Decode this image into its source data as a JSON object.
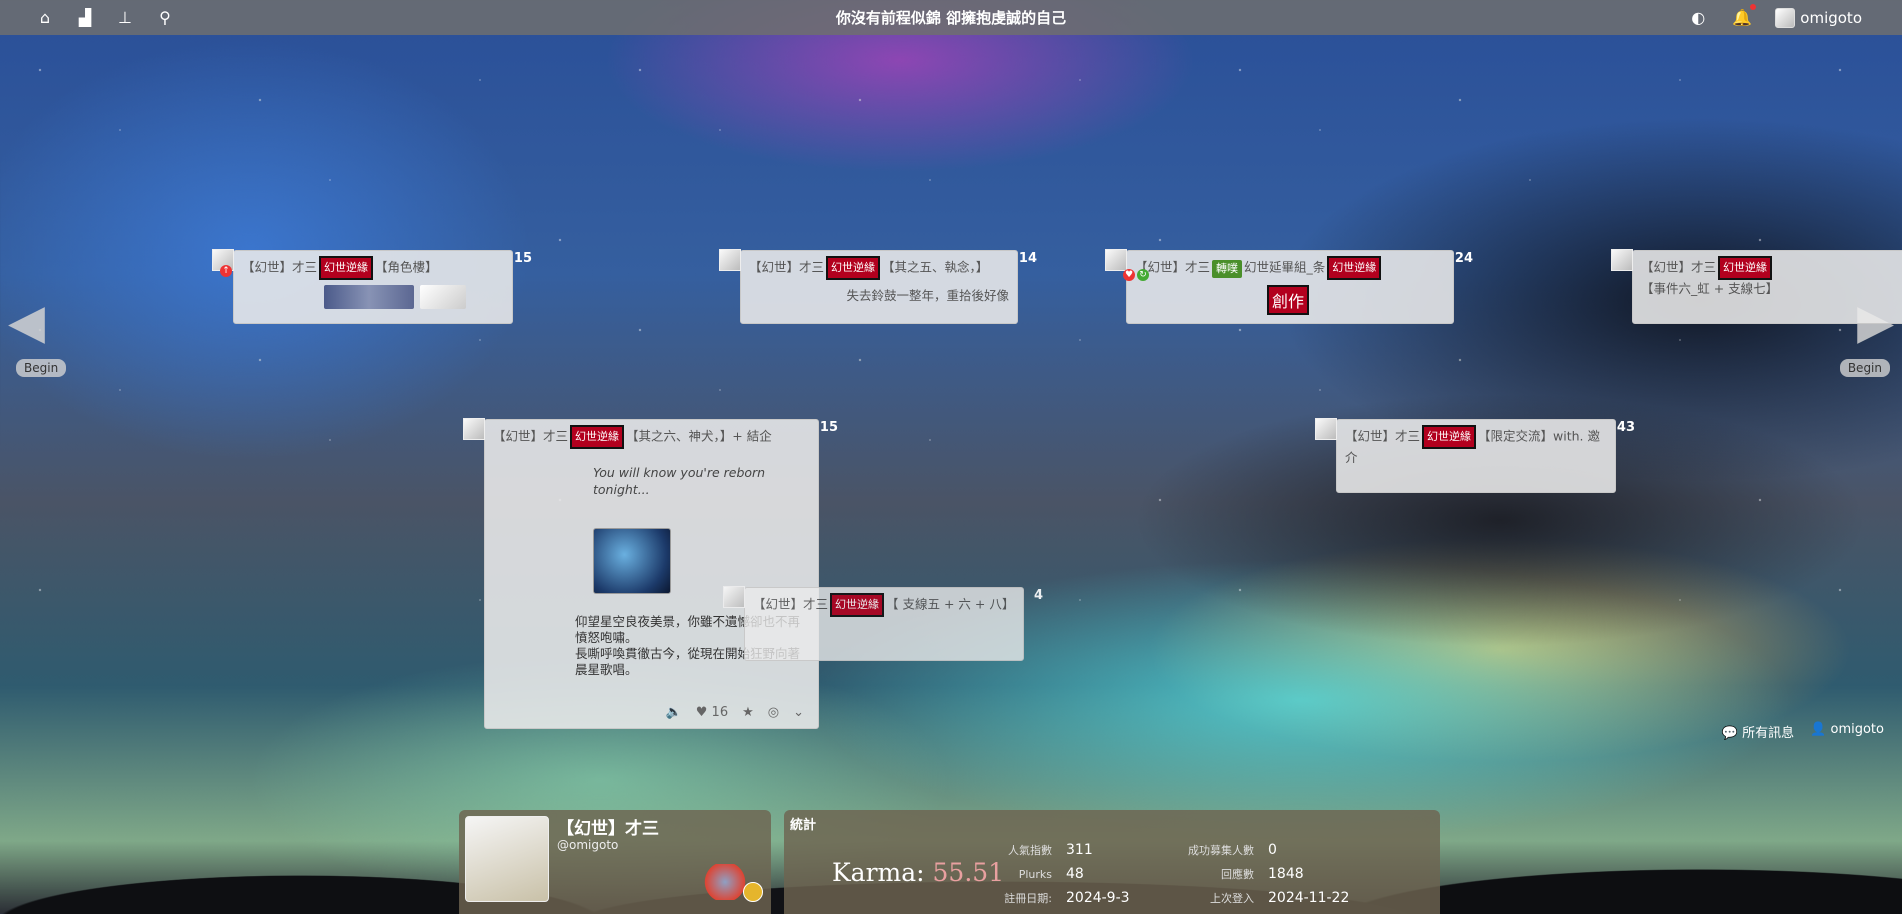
{
  "topbar": {
    "title": "你沒有前程似錦 卻擁抱虔誠的自己",
    "username": "omigoto"
  },
  "nav": {
    "begin_left": "Begin",
    "begin_right": "Begin"
  },
  "plurks": [
    {
      "prefix": "【幻世】才三",
      "tag": "幻世逆緣",
      "text": "【角色樓】",
      "count": "15"
    },
    {
      "prefix": "【幻世】才三",
      "tag": "幻世逆緣",
      "text": "【其之五、執念，】",
      "body": "失去鈴鼓一整年，重拾後好像",
      "count": "14"
    },
    {
      "prefix": "【幻世】才三",
      "green": "轉噗",
      "text": "幻世延畢組_条",
      "tag": "幻世逆緣",
      "badge": "創作",
      "count": "24"
    },
    {
      "prefix": "【幻世】才三",
      "tag": "幻世逆緣",
      "text": "【事件六_虹 + 支線七】",
      "count": ""
    },
    {
      "prefix": "【幻世】才三",
      "tag": "幻世逆緣",
      "text": "【其之六、神犬，】+ 結企",
      "count": "15",
      "quote": "You will know you're reborn tonight...",
      "poem": [
        "仰望星空良夜美景，你雖不遺憾卻也不再憤怒咆嘯。",
        "長嘶呼喚貫徹古今，從現在開始狂野向著晨星歌唱。"
      ],
      "likes": "16"
    },
    {
      "prefix": "【幻世】才三",
      "tag": "幻世逆緣",
      "text": "【限定交流】with. 邀介",
      "count": "43"
    },
    {
      "prefix": "【幻世】才三",
      "tag": "幻世逆緣",
      "text": "【 支線五 + 六 + 八】",
      "count": "4"
    }
  ],
  "links": {
    "all_messages": "所有訊息",
    "owner": "omigoto"
  },
  "profile": {
    "name": "【幻世】才三",
    "handle": "@omigoto"
  },
  "stats": {
    "title": "統計",
    "karma_label": "Karma:",
    "karma_value": "55.51",
    "items": [
      {
        "label": "人氣指數",
        "value": "311"
      },
      {
        "label": "Plurks",
        "value": "48"
      },
      {
        "label": "註冊日期:",
        "value": "2024-9-3"
      },
      {
        "label": "成功募集人數",
        "value": "0"
      },
      {
        "label": "回應數",
        "value": "1848"
      },
      {
        "label": "上次登入",
        "value": "2024-11-22"
      }
    ]
  }
}
